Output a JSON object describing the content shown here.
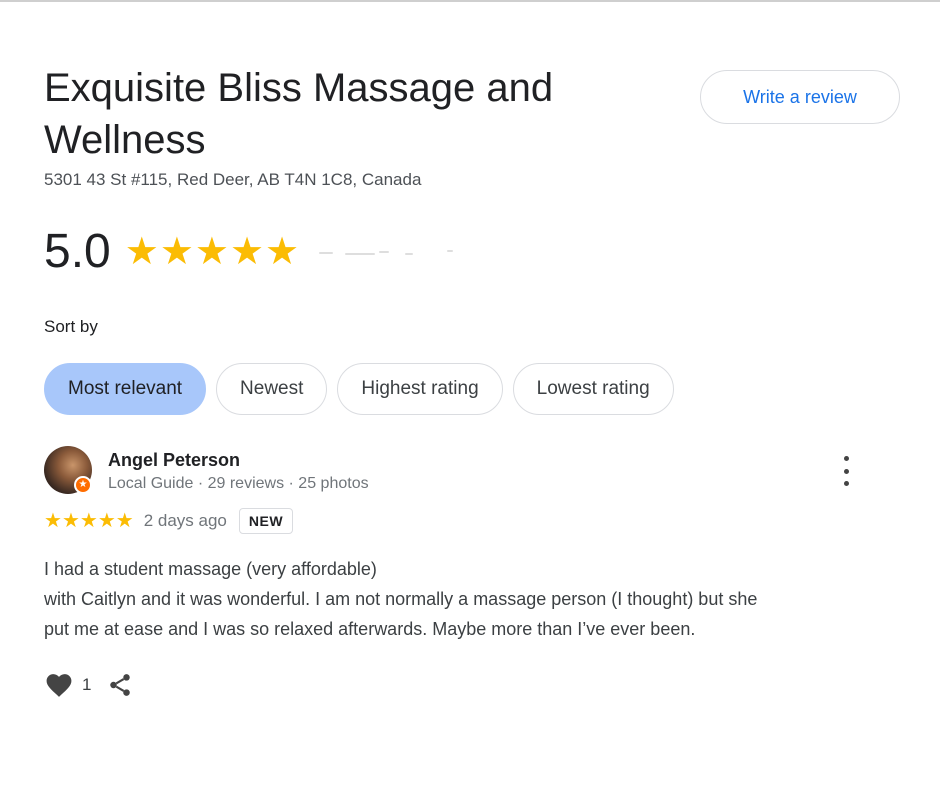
{
  "business": {
    "name": "Exquisite Bliss Massage and Wellness",
    "address": "5301 43 St #115, Red Deer, AB T4N 1C8, Canada",
    "rating": "5.0",
    "stars": "★★★★★"
  },
  "actions": {
    "write_review_label": "Write a review"
  },
  "sort": {
    "label": "Sort by",
    "options": [
      "Most relevant",
      "Newest",
      "Highest rating",
      "Lowest rating"
    ],
    "selected": "Most relevant"
  },
  "review": {
    "author": "Angel Peterson",
    "meta": "Local Guide · 29 reviews · 25 photos",
    "stars": "★★★★★",
    "date": "2 days ago",
    "badge": "NEW",
    "text_lines": [
      "I had a student massage (very affordable)",
      "with Caitlyn and it was wonderful. I am not normally a massage person (I thought) but she",
      "put me at ease and I was so relaxed afterwards. Maybe more than I’ve ever been."
    ],
    "likes": "1"
  },
  "colors": {
    "star": "#fbbc04",
    "accent_blue": "#1a73e8",
    "active_chip": "#a8c7fa"
  }
}
